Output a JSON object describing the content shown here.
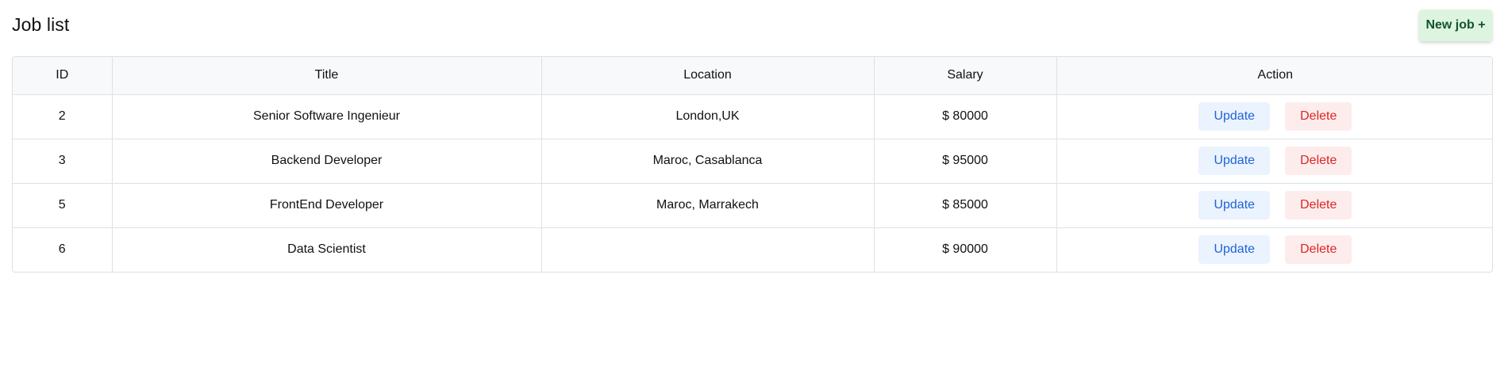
{
  "header": {
    "title": "Job list",
    "new_job_label": "New job +"
  },
  "table": {
    "columns": [
      "ID",
      "Title",
      "Location",
      "Salary",
      "Action"
    ],
    "rows": [
      {
        "id": "2",
        "title": "Senior Software Ingenieur",
        "location": "London,UK",
        "salary": "$ 80000"
      },
      {
        "id": "3",
        "title": "Backend Developer",
        "location": "Maroc, Casablanca",
        "salary": "$ 95000"
      },
      {
        "id": "5",
        "title": "FrontEnd Developer",
        "location": "Maroc, Marrakech",
        "salary": "$ 85000"
      },
      {
        "id": "6",
        "title": "Data Scientist",
        "location": "",
        "salary": "$ 90000"
      }
    ],
    "update_label": "Update",
    "delete_label": "Delete"
  },
  "colors": {
    "new_job_bg": "#ddf5e0",
    "update_bg": "#ebf3fe",
    "update_text": "#1f63d6",
    "delete_bg": "#fdecec",
    "delete_text": "#dc2626",
    "header_row_bg": "#f8f9fa"
  }
}
